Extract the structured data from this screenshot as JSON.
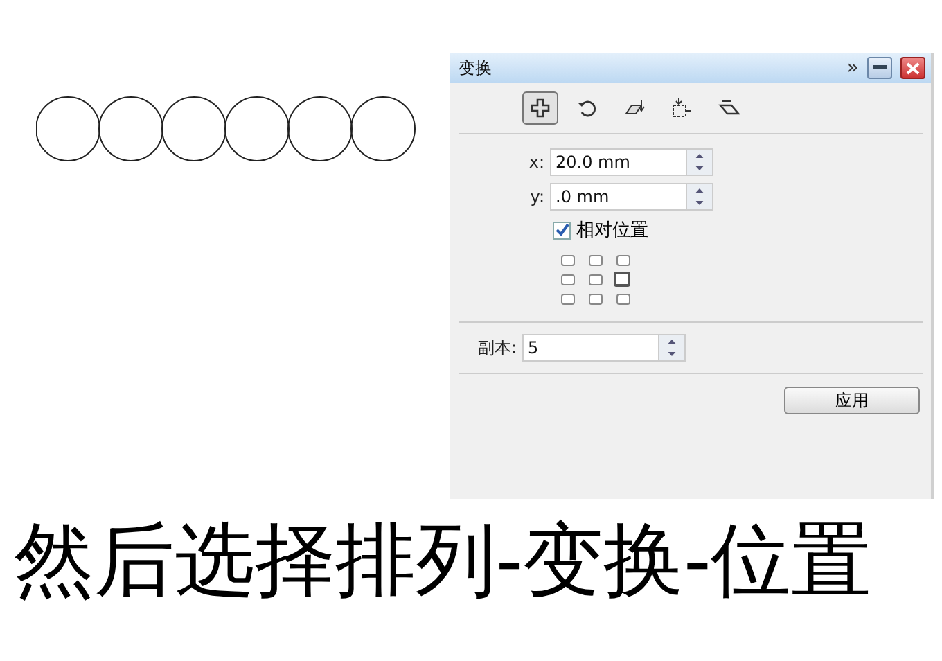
{
  "canvas_shapes": [
    {
      "kind": "circle"
    },
    {
      "kind": "circle"
    },
    {
      "kind": "circle"
    },
    {
      "kind": "circle"
    },
    {
      "kind": "circle"
    },
    {
      "kind": "circle"
    }
  ],
  "panel": {
    "title": "变换",
    "expand_glyph": "»",
    "tools": [
      {
        "kind": "position",
        "selected": true
      },
      {
        "kind": "rotate",
        "selected": false
      },
      {
        "kind": "scale",
        "selected": false
      },
      {
        "kind": "size",
        "selected": false
      },
      {
        "kind": "skew",
        "selected": false
      }
    ],
    "x_field": {
      "label": "x:",
      "value": "20.0 mm"
    },
    "y_field": {
      "label": "y:",
      "value": ".0 mm"
    },
    "relative_position": {
      "label": "相对位置",
      "checked": true
    },
    "anchors": [
      {
        "selected": false
      },
      {
        "selected": false
      },
      {
        "selected": false
      },
      {
        "selected": false
      },
      {
        "selected": false
      },
      {
        "selected": true
      },
      {
        "selected": false
      },
      {
        "selected": false
      },
      {
        "selected": false
      }
    ],
    "copies_field": {
      "label": "副本:",
      "value": "5"
    },
    "apply_button": "应用"
  },
  "caption": "然后选择排列-变换-位置"
}
